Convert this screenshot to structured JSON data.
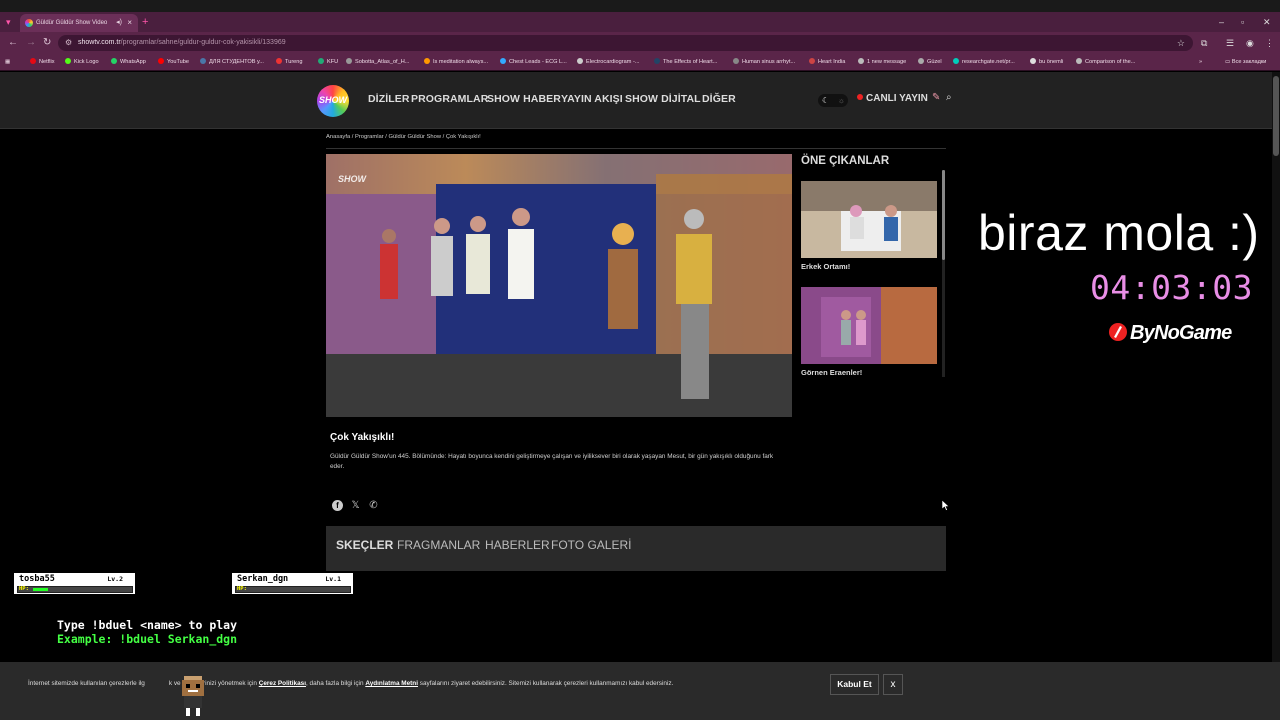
{
  "browser": {
    "tab_title": "Güldür Güldür Show Video",
    "url_host": "showtv.com.tr",
    "url_path": "/programlar/sahne/guldur-guldur-cok-yakisikli/133969",
    "bookmarks": [
      "Netflix",
      "Kick Logo",
      "WhatsApp",
      "YouTube",
      "ДЛЯ СТУДЕНТОВ у...",
      "Tureng",
      "KFU",
      "Sobotta_Atlas_of_H...",
      "Is meditation always...",
      "Chest Leads - ECG L...",
      "Electrocardiogram -...",
      "The Effects of Heart...",
      "Human sinus arrhyt...",
      "Heart India",
      "1 new message",
      "Güzel",
      "researchgate.net/pr...",
      "bu önemli",
      "Comparison of the..."
    ],
    "bookmarks_other": "Все закладки"
  },
  "site": {
    "logo_text": "SHOW",
    "nav": [
      "DİZİLER",
      "PROGRAMLAR",
      "SHOW HABER",
      "YAYIN AKIŞI",
      "SHOW DİJİTAL",
      "DİĞER"
    ],
    "live_label": "CANLI YAYIN",
    "breadcrumb": "Anasayfa / Programlar / Güldür Güldür Show / Çok Yakışıklı!",
    "video_title": "Çok Yakışıklı!",
    "video_desc": "Güldür Güldür Show'un 445. Bölümünde: Hayatı boyunca kendini geliştirmeye çalışan ve iyiliksever biri olarak yaşayan Mesut, bir gün yakışıklı olduğunu fark eder.",
    "highlights_title": "ÖNE ÇIKANLAR",
    "highlights": [
      "Erkek Ortamı!",
      "Görnen Eraenler!"
    ],
    "tabs": [
      "SKEÇLER",
      "FRAGMANLAR",
      "HABERLER",
      "FOTO GALERİ"
    ],
    "player_watermark": "SHOW"
  },
  "overlay": {
    "break_text": "biraz mola :)",
    "timer": "04:03:03",
    "sponsor": "ByNoGame",
    "duel_players": [
      {
        "name": "tosba55",
        "level": "Lv.2",
        "hp_label": "HP:",
        "hp_fraction": 0.15
      },
      {
        "name": "Serkan_dgn",
        "level": "Lv.1",
        "hp_label": "HP:",
        "hp_fraction": 0.0
      }
    ],
    "duel_line1": "Type !bduel <name> to play",
    "duel_line2": "Example: !bduel Serkan_dgn"
  },
  "cookie": {
    "text_start": "İnternet sitemizde kullanılan çerezlerle ilg",
    "text_mid1": "k ve tercihlerinizi yönetmek için ",
    "link1": "Çerez Politikası",
    "text_mid2": ", daha fazla bilgi için ",
    "link2": "Aydınlatma Metni",
    "text_end": " sayfalarını ziyaret edebilirsiniz. Sitemizi kullanarak çerezleri kullanmamızı kabul edersiniz.",
    "accept_label": "Kabul Et",
    "close_label": "x"
  },
  "colors": {
    "accent_pink": "#e98ee6",
    "duel_green": "#44ff44",
    "live_red": "#ee2222"
  }
}
